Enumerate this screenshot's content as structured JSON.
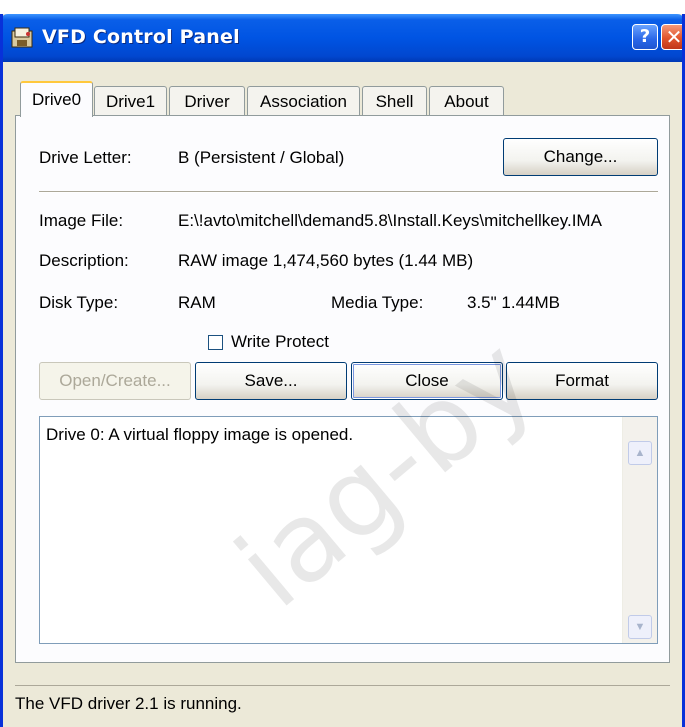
{
  "window": {
    "title": "VFD Control Panel",
    "help_label": "?",
    "close_label": "✕"
  },
  "tabs": [
    {
      "label": "Drive0",
      "active": true
    },
    {
      "label": "Drive1"
    },
    {
      "label": "Driver"
    },
    {
      "label": "Association"
    },
    {
      "label": "Shell"
    },
    {
      "label": "About"
    }
  ],
  "drive": {
    "drive_letter_label": "Drive Letter:",
    "drive_letter_value": "B (Persistent / Global)",
    "change_button": "Change...",
    "image_file_label": "Image File:",
    "image_file_value": "E:\\!avto\\mitchell\\demand5.8\\Install.Keys\\mitchellkey.IMA",
    "description_label": "Description:",
    "description_value": "RAW image 1,474,560 bytes (1.44 MB)",
    "disk_type_label": "Disk Type:",
    "disk_type_value": "RAM",
    "media_type_label": "Media Type:",
    "media_type_value": "3.5\"  1.44MB",
    "write_protect_label": "Write Protect",
    "write_protect_checked": false
  },
  "buttons": {
    "open_create": "Open/Create...",
    "save": "Save...",
    "close": "Close",
    "format": "Format"
  },
  "log": {
    "text": "Drive 0: A virtual floppy image is opened."
  },
  "status": {
    "text": "The VFD driver 2.1 is running."
  },
  "watermark": "iag-by"
}
